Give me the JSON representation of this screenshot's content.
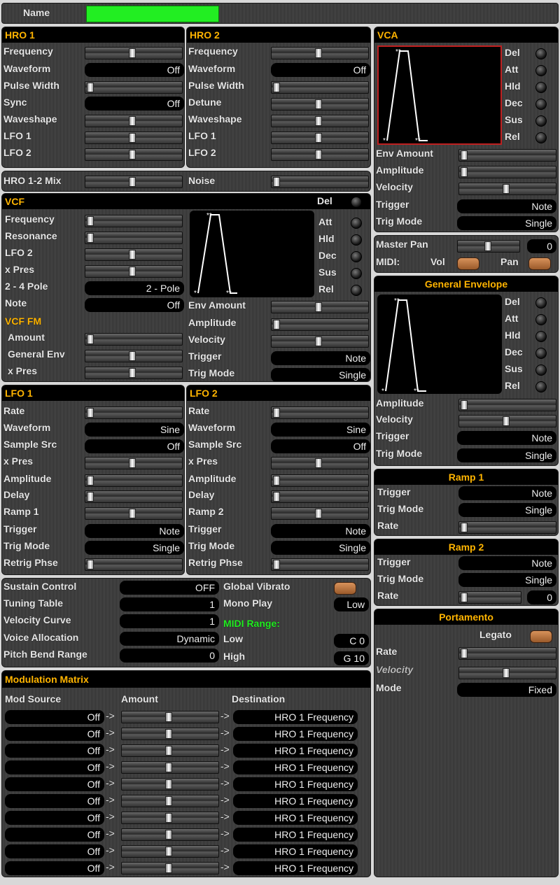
{
  "name_label": "Name",
  "hro1": {
    "title": "HRO 1",
    "frequency": "Frequency",
    "waveform": "Waveform",
    "waveform_val": "Off",
    "pulse_width": "Pulse Width",
    "sync": "Sync",
    "sync_val": "Off",
    "waveshape": "Waveshape",
    "lfo1": "LFO 1",
    "lfo2": "LFO 2"
  },
  "hro2": {
    "title": "HRO 2",
    "frequency": "Frequency",
    "waveform": "Waveform",
    "waveform_val": "Off",
    "pulse_width": "Pulse Width",
    "detune": "Detune",
    "waveshape": "Waveshape",
    "lfo1": "LFO 1",
    "lfo2": "LFO 2"
  },
  "mix": {
    "hro_mix": "HRO 1-2 Mix",
    "noise": "Noise"
  },
  "vcf": {
    "title": "VCF",
    "frequency": "Frequency",
    "resonance": "Resonance",
    "lfo2": "LFO 2",
    "x_pres": "x Pres",
    "pole": "2 - 4 Pole",
    "pole_val": "2 - Pole",
    "note": "Note",
    "note_val": "Off",
    "fm_title": "VCF FM",
    "amount": "Amount",
    "general_env": "General Env",
    "fm_x_pres": "x Pres",
    "env_amount": "Env Amount",
    "amplitude": "Amplitude",
    "velocity": "Velocity",
    "trigger": "Trigger",
    "trigger_val": "Note",
    "trig_mode": "Trig Mode",
    "trig_mode_val": "Single",
    "del": "Del",
    "att": "Att",
    "hld": "Hld",
    "dec": "Dec",
    "sus": "Sus",
    "rel": "Rel"
  },
  "vca": {
    "title": "VCA",
    "del": "Del",
    "att": "Att",
    "hld": "Hld",
    "dec": "Dec",
    "sus": "Sus",
    "rel": "Rel",
    "env_amount": "Env Amount",
    "amplitude": "Amplitude",
    "velocity": "Velocity",
    "trigger": "Trigger",
    "trigger_val": "Note",
    "trig_mode": "Trig Mode",
    "trig_mode_val": "Single"
  },
  "master": {
    "pan": "Master Pan",
    "pan_val": "0",
    "midi": "MIDI:",
    "vol": "Vol",
    "pan2": "Pan"
  },
  "genenv": {
    "title": "General Envelope",
    "del": "Del",
    "att": "Att",
    "hld": "Hld",
    "dec": "Dec",
    "sus": "Sus",
    "rel": "Rel",
    "amplitude": "Amplitude",
    "velocity": "Velocity",
    "trigger": "Trigger",
    "trigger_val": "Note",
    "trig_mode": "Trig Mode",
    "trig_mode_val": "Single"
  },
  "ramp1": {
    "title": "Ramp 1",
    "trigger": "Trigger",
    "trigger_val": "Note",
    "trig_mode": "Trig Mode",
    "trig_mode_val": "Single",
    "rate": "Rate"
  },
  "ramp2": {
    "title": "Ramp 2",
    "trigger": "Trigger",
    "trigger_val": "Note",
    "trig_mode": "Trig Mode",
    "trig_mode_val": "Single",
    "rate": "Rate",
    "rate_val": "0"
  },
  "porta": {
    "title": "Portamento",
    "legato": "Legato",
    "rate": "Rate",
    "velocity": "Velocity",
    "mode": "Mode",
    "mode_val": "Fixed"
  },
  "lfo1": {
    "title": "LFO 1",
    "rate": "Rate",
    "waveform": "Waveform",
    "waveform_val": "Sine",
    "sample_src": "Sample Src",
    "sample_src_val": "Off",
    "x_pres": "x Pres",
    "amplitude": "Amplitude",
    "delay": "Delay",
    "ramp": "Ramp 1",
    "trigger": "Trigger",
    "trigger_val": "Note",
    "trig_mode": "Trig Mode",
    "trig_mode_val": "Single",
    "retrig": "Retrig Phse"
  },
  "lfo2": {
    "title": "LFO 2",
    "rate": "Rate",
    "waveform": "Waveform",
    "waveform_val": "Sine",
    "sample_src": "Sample Src",
    "sample_src_val": "Off",
    "x_pres": "x Pres",
    "amplitude": "Amplitude",
    "delay": "Delay",
    "ramp": "Ramp 2",
    "trigger": "Trigger",
    "trigger_val": "Note",
    "trig_mode": "Trig Mode",
    "trig_mode_val": "Single",
    "retrig": "Retrig Phse"
  },
  "global": {
    "sustain": "Sustain Control",
    "sustain_val": "OFF",
    "tuning": "Tuning Table",
    "tuning_val": "1",
    "velocity_curve": "Velocity Curve",
    "velocity_curve_val": "1",
    "voice_alloc": "Voice Allocation",
    "voice_alloc_val": "Dynamic",
    "pitch_bend": "Pitch Bend Range",
    "pitch_bend_val": "0",
    "global_vibrato": "Global Vibrato",
    "mono_play": "Mono Play",
    "mono_play_val": "Low",
    "midi_range": "MIDI Range:",
    "low": "Low",
    "low_val": "C 0",
    "high": "High",
    "high_val": "G 10"
  },
  "matrix": {
    "title": "Modulation Matrix",
    "col_source": "Mod Source",
    "col_amount": "Amount",
    "col_dest": "Destination",
    "rows": [
      {
        "source": "Off",
        "arrow1": "->",
        "arrow2": "->",
        "dest": "HRO 1 Frequency"
      },
      {
        "source": "Off",
        "arrow1": "->",
        "arrow2": "->",
        "dest": "HRO 1 Frequency"
      },
      {
        "source": "Off",
        "arrow1": "->",
        "arrow2": "->",
        "dest": "HRO 1 Frequency"
      },
      {
        "source": "Off",
        "arrow1": "->",
        "arrow2": "->",
        "dest": "HRO 1 Frequency"
      },
      {
        "source": "Off",
        "arrow1": "->",
        "arrow2": "->",
        "dest": "HRO 1 Frequency"
      },
      {
        "source": "Off",
        "arrow1": "->",
        "arrow2": "->",
        "dest": "HRO 1 Frequency"
      },
      {
        "source": "Off",
        "arrow1": "->",
        "arrow2": "->",
        "dest": "HRO 1 Frequency"
      },
      {
        "source": "Off",
        "arrow1": "->",
        "arrow2": "->",
        "dest": "HRO 1 Frequency"
      },
      {
        "source": "Off",
        "arrow1": "->",
        "arrow2": "->",
        "dest": "HRO 1 Frequency"
      },
      {
        "source": "Off",
        "arrow1": "->",
        "arrow2": "->",
        "dest": "HRO 1 Frequency"
      }
    ]
  },
  "colors": {
    "name_field": "#22ee22",
    "header_text": "#ffb400",
    "midi_range": "#22ee22",
    "toggle": "#c07a45"
  }
}
